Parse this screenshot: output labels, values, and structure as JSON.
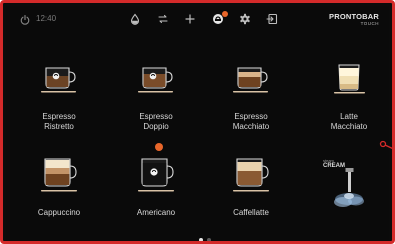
{
  "topbar": {
    "time": "12:40",
    "icons": [
      "power-icon",
      "water-drop-icon",
      "swap-icon",
      "plus-icon",
      "coffee-count-icon",
      "gear-icon",
      "exit-icon"
    ]
  },
  "brand": {
    "name": "PRONTOBAR",
    "sub": "TOUCH"
  },
  "drinks": [
    {
      "line1": "Espresso",
      "line2": "Ristretto"
    },
    {
      "line1": "Espresso",
      "line2": "Doppio"
    },
    {
      "line1": "Espresso",
      "line2": "Macchiato"
    },
    {
      "line1": "Latte",
      "line2": "Macchiato"
    },
    {
      "line1": "Cappuccino"
    },
    {
      "line1": "Americano"
    },
    {
      "line1": "Caffellatte"
    }
  ],
  "steam_cream": {
    "line1": "steam",
    "line2": "CREAM"
  },
  "pager": {
    "pages": 2,
    "active": 1
  },
  "colors": {
    "accent": "#e8662a",
    "frame": "#d42a2a",
    "background": "#0a0a0a",
    "label": "#d8d8d8"
  }
}
